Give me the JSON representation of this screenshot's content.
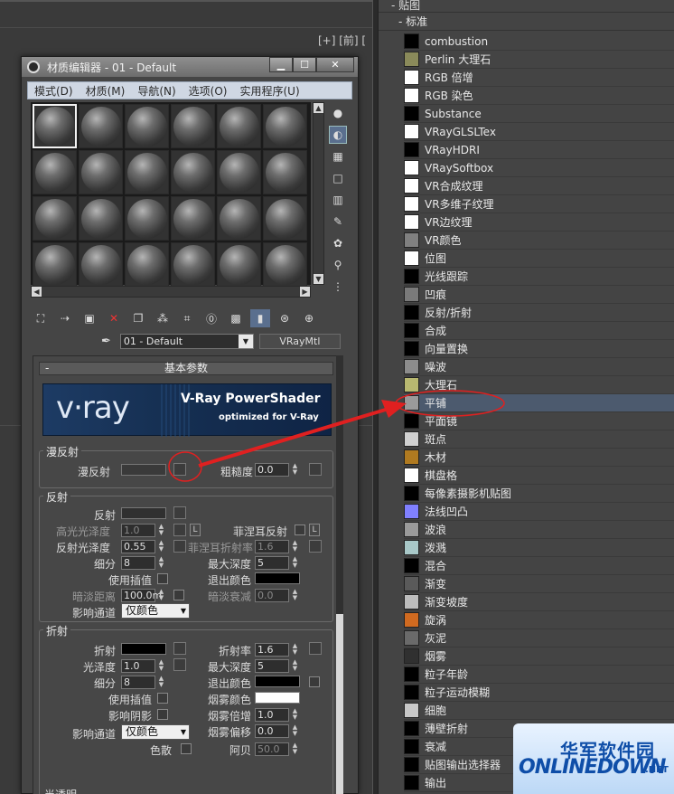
{
  "viewport": {
    "label": "[+] [前] ["
  },
  "browser": {
    "header": "- 贴图",
    "subheader": "- 标准",
    "maps": [
      {
        "label": "combustion",
        "swatch": "#000000"
      },
      {
        "label": "Perlin 大理石",
        "swatch": "#8a8a5a"
      },
      {
        "label": "RGB 倍增",
        "swatch": "#ffffff"
      },
      {
        "label": "RGB 染色",
        "swatch": "#ffffff"
      },
      {
        "label": "Substance",
        "swatch": "#000000"
      },
      {
        "label": "VRayGLSLTex",
        "swatch": "#ffffff"
      },
      {
        "label": "VRayHDRI",
        "swatch": "#000000"
      },
      {
        "label": "VRaySoftbox",
        "swatch": "#ffffff"
      },
      {
        "label": "VR合成纹理",
        "swatch": "#ffffff"
      },
      {
        "label": "VR多维子纹理",
        "swatch": "#ffffff"
      },
      {
        "label": "VR边纹理",
        "swatch": "#ffffff"
      },
      {
        "label": "VR颜色",
        "swatch": "#808080"
      },
      {
        "label": "位图",
        "swatch": "#ffffff"
      },
      {
        "label": "光线跟踪",
        "swatch": "#000000"
      },
      {
        "label": "凹痕",
        "swatch": "#7a7a7a"
      },
      {
        "label": "反射/折射",
        "swatch": "#000000"
      },
      {
        "label": "合成",
        "swatch": "#000000"
      },
      {
        "label": "向量置换",
        "swatch": "#000000"
      },
      {
        "label": "噪波",
        "swatch": "#8c8c8c"
      },
      {
        "label": "大理石",
        "swatch": "#b8b870"
      },
      {
        "label": "平铺",
        "swatch": "#9a9a9a"
      },
      {
        "label": "平面镜",
        "swatch": "#000000"
      },
      {
        "label": "斑点",
        "swatch": "#d0d0d0"
      },
      {
        "label": "木材",
        "swatch": "#b07a20"
      },
      {
        "label": "棋盘格",
        "swatch": "#ffffff"
      },
      {
        "label": "每像素摄影机贴图",
        "swatch": "#000000"
      },
      {
        "label": "法线凹凸",
        "swatch": "#8080ff"
      },
      {
        "label": "波浪",
        "swatch": "#9a9a9a"
      },
      {
        "label": "泼溅",
        "swatch": "#a8c8c8"
      },
      {
        "label": "混合",
        "swatch": "#000000"
      },
      {
        "label": "渐变",
        "swatch": "#5a5a5a"
      },
      {
        "label": "渐变坡度",
        "swatch": "#bdbdbd"
      },
      {
        "label": "旋涡",
        "swatch": "#d06a20"
      },
      {
        "label": "灰泥",
        "swatch": "#6a6a6a"
      },
      {
        "label": "烟雾",
        "swatch": "#303030"
      },
      {
        "label": "粒子年龄",
        "swatch": "#000000"
      },
      {
        "label": "粒子运动模糊",
        "swatch": "#000000"
      },
      {
        "label": "细胞",
        "swatch": "#c8c8c8"
      },
      {
        "label": "薄壁折射",
        "swatch": "#000000"
      },
      {
        "label": "衰减",
        "swatch": "#000000"
      },
      {
        "label": "贴图输出选择器",
        "swatch": "#000000"
      },
      {
        "label": "输出",
        "swatch": "#000000"
      }
    ],
    "selected_index": 20
  },
  "mat_editor": {
    "title": "材质编辑器 - 01 - Default",
    "window_buttons": {
      "minimize": "▁",
      "maximize": "☐",
      "close": "✕"
    },
    "menu": [
      "模式(D)",
      "材质(M)",
      "导航(N)",
      "选项(O)",
      "实用程序(U)"
    ],
    "material_name": "01 - Default",
    "material_type": "VRayMtl",
    "rollout_title": "基本参数",
    "rollout_minus": "-",
    "banner": {
      "logo": "v·ray",
      "title": "V-Ray PowerShader",
      "subtitle": "optimized for V-Ray"
    },
    "diffuse": {
      "group": "漫反射",
      "diffuse_label": "漫反射",
      "roughness_label": "粗糙度",
      "roughness_value": "0.0"
    },
    "reflection": {
      "group": "反射",
      "reflect_label": "反射",
      "hilight_gloss_label": "高光光泽度",
      "hilight_gloss_value": "1.0",
      "lock_label": "L",
      "fresnel_label": "菲涅耳反射",
      "fresnel_lock_label": "L",
      "refl_gloss_label": "反射光泽度",
      "refl_gloss_value": "0.55",
      "fresnel_ior_label": "菲涅耳折射率",
      "fresnel_ior_value": "1.6",
      "subdivs_label": "细分",
      "subdivs_value": "8",
      "max_depth_label": "最大深度",
      "max_depth_value": "5",
      "use_interp_label": "使用插值",
      "exit_color_label": "退出颜色",
      "dim_dist_label": "暗淡距离",
      "dim_dist_value": "100.0m",
      "dim_falloff_label": "暗淡衰减",
      "dim_falloff_value": "0.0",
      "affect_channels_label": "影响通道",
      "affect_channels_value": "仅颜色"
    },
    "refraction": {
      "group": "折射",
      "refract_label": "折射",
      "ior_label": "折射率",
      "ior_value": "1.6",
      "gloss_label": "光泽度",
      "gloss_value": "1.0",
      "max_depth_label": "最大深度",
      "max_depth_value": "5",
      "subdivs_label": "细分",
      "subdivs_value": "8",
      "exit_color_label": "退出颜色",
      "use_interp_label": "使用插值",
      "fog_color_label": "烟雾颜色",
      "affect_shadows_label": "影响阴影",
      "fog_mult_label": "烟雾倍增",
      "fog_mult_value": "1.0",
      "affect_channels_label": "影响通道",
      "affect_channels_value": "仅颜色",
      "fog_bias_label": "烟雾偏移",
      "fog_bias_value": "0.0",
      "dispersion_label": "色散",
      "abbe_label": "阿贝",
      "abbe_value": "50.0",
      "translucency_label": "半透明"
    }
  },
  "watermark": {
    "cn": "华军软件园",
    "en": "ONLINEDOWN",
    "net": ".NET"
  },
  "colors": {
    "window_bg": "#454545",
    "menubar_bg": "#cfd7e3",
    "selected_row": "#4c5a6e",
    "annotation_red": "#e02020",
    "banner_blue": "#1d3b64"
  }
}
